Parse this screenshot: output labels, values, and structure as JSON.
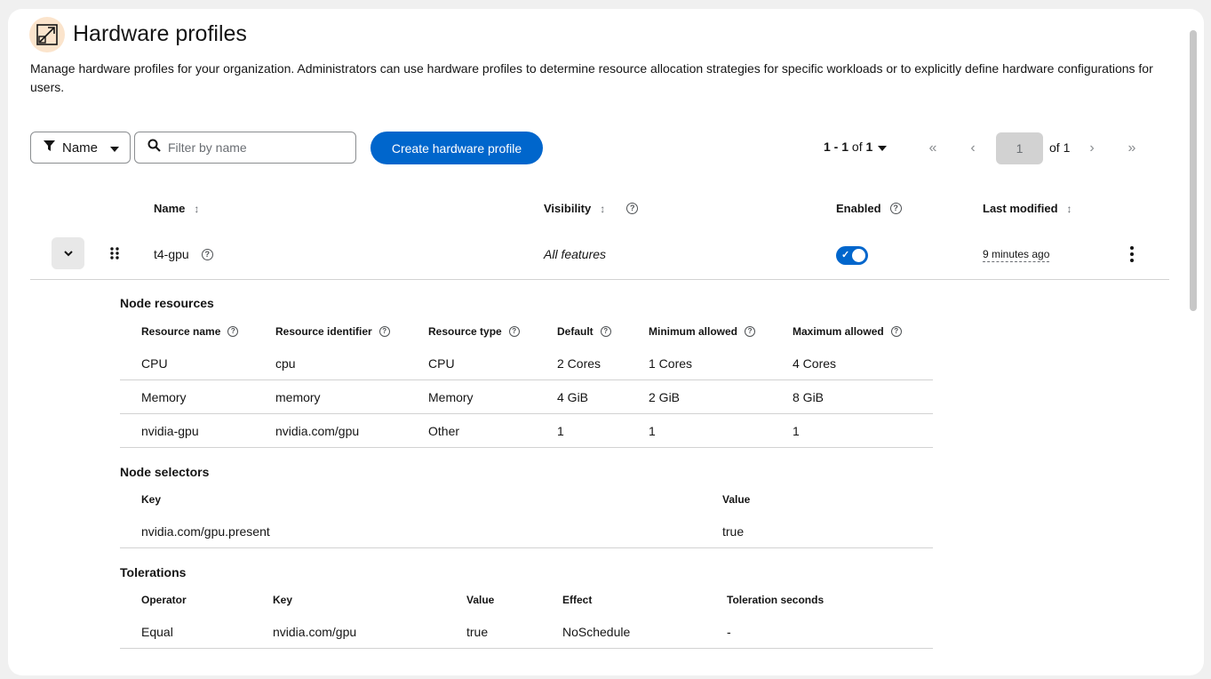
{
  "page": {
    "title": "Hardware profiles",
    "description": "Manage hardware profiles for your organization. Administrators can use hardware profiles to determine resource allocation strategies for specific workloads or to explicitly define hardware configurations for users."
  },
  "toolbar": {
    "filter_attribute": "Name",
    "search_placeholder": "Filter by name",
    "create_label": "Create hardware profile"
  },
  "pagination": {
    "range": "1 - 1",
    "of_word": "of",
    "total": "1",
    "current_page": "1",
    "of_pages": "of 1"
  },
  "table": {
    "headers": {
      "name": "Name",
      "visibility": "Visibility",
      "enabled": "Enabled",
      "last_modified": "Last modified"
    },
    "row": {
      "name": "t4-gpu",
      "visibility": "All features",
      "enabled": true,
      "last_modified": "9 minutes ago"
    }
  },
  "node_resources": {
    "title": "Node resources",
    "headers": [
      "Resource name",
      "Resource identifier",
      "Resource type",
      "Default",
      "Minimum allowed",
      "Maximum allowed"
    ],
    "rows": [
      [
        "CPU",
        "cpu",
        "CPU",
        "2 Cores",
        "1 Cores",
        "4 Cores"
      ],
      [
        "Memory",
        "memory",
        "Memory",
        "4 GiB",
        "2 GiB",
        "8 GiB"
      ],
      [
        "nvidia-gpu",
        "nvidia.com/gpu",
        "Other",
        "1",
        "1",
        "1"
      ]
    ]
  },
  "node_selectors": {
    "title": "Node selectors",
    "headers": [
      "Key",
      "Value"
    ],
    "rows": [
      [
        "nvidia.com/gpu.present",
        "true"
      ]
    ]
  },
  "tolerations": {
    "title": "Tolerations",
    "headers": [
      "Operator",
      "Key",
      "Value",
      "Effect",
      "Toleration seconds"
    ],
    "rows": [
      [
        "Equal",
        "nvidia.com/gpu",
        "true",
        "NoSchedule",
        "-"
      ]
    ]
  },
  "colors": {
    "primary": "#0066cc",
    "icon_bg": "#fbe4cc"
  }
}
